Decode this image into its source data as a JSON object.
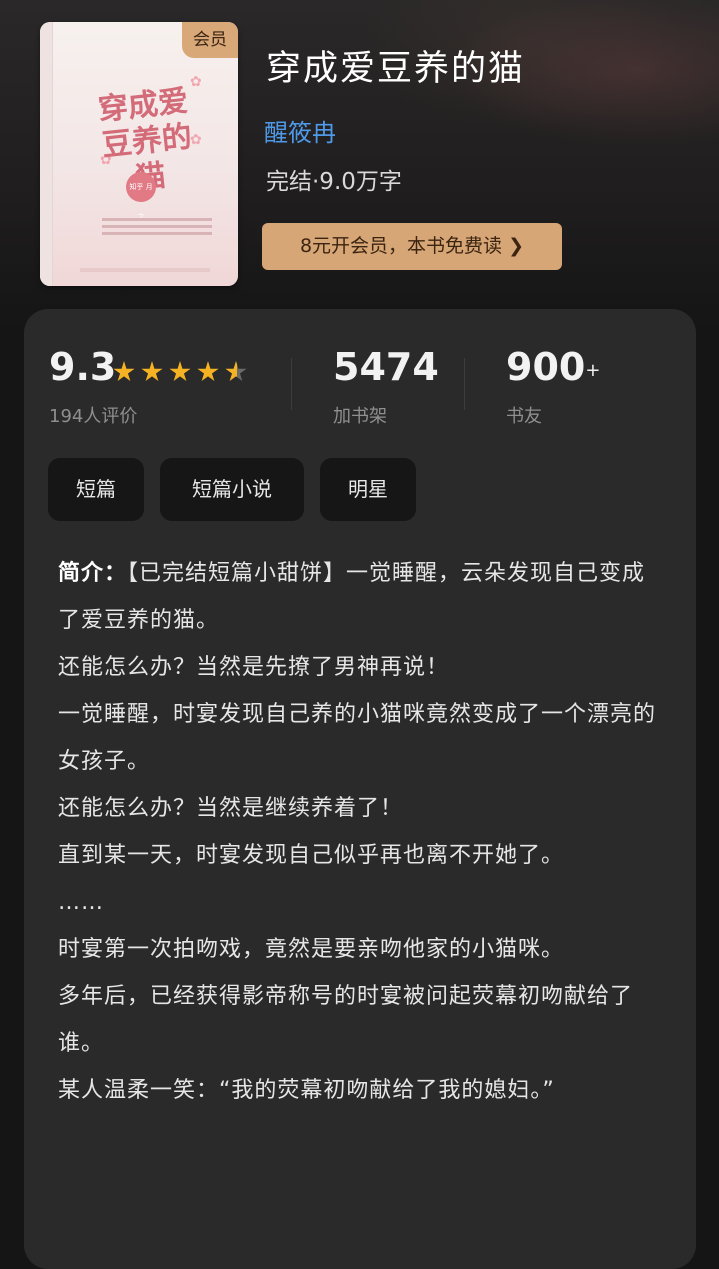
{
  "book": {
    "cover": {
      "badge": "会员",
      "title_art": "穿成爱豆养的猫",
      "circle_text": "知乎 月之"
    },
    "title": "穿成爱豆养的猫",
    "author": "醒筱冉",
    "status": "完结·9.0万字",
    "vip_button": "8元开会员，本书免费读 ❯"
  },
  "stats": {
    "rating": "9.3",
    "rating_stars": 4.5,
    "rating_count": "194人评价",
    "shelf_count": "5474",
    "shelf_label": "加书架",
    "friends_count": "900",
    "friends_plus": "+",
    "friends_label": "书友"
  },
  "tags": [
    "短篇",
    "短篇小说",
    "明星"
  ],
  "intro": {
    "label": "简介：",
    "lines": [
      "【已完结短篇小甜饼】一觉睡醒，云朵发现自己变成了爱豆养的猫。",
      "还能怎么办？当然是先撩了男神再说！",
      "一觉睡醒，时宴发现自己养的小猫咪竟然变成了一个漂亮的女孩子。",
      "还能怎么办？当然是继续养着了！",
      "直到某一天，时宴发现自己似乎再也离不开她了。",
      "……",
      "时宴第一次拍吻戏，竟然是要亲吻他家的小猫咪。",
      "多年后，已经获得影帝称号的时宴被问起荧幕初吻献给了谁。",
      "某人温柔一笑：“我的荧幕初吻献给了我的媳妇。”"
    ]
  },
  "colors": {
    "background": "#151515",
    "card": "#2a2a2a",
    "author_link": "#4f9ae8",
    "vip_gold": "#d7a676",
    "star": "#f5b324"
  }
}
